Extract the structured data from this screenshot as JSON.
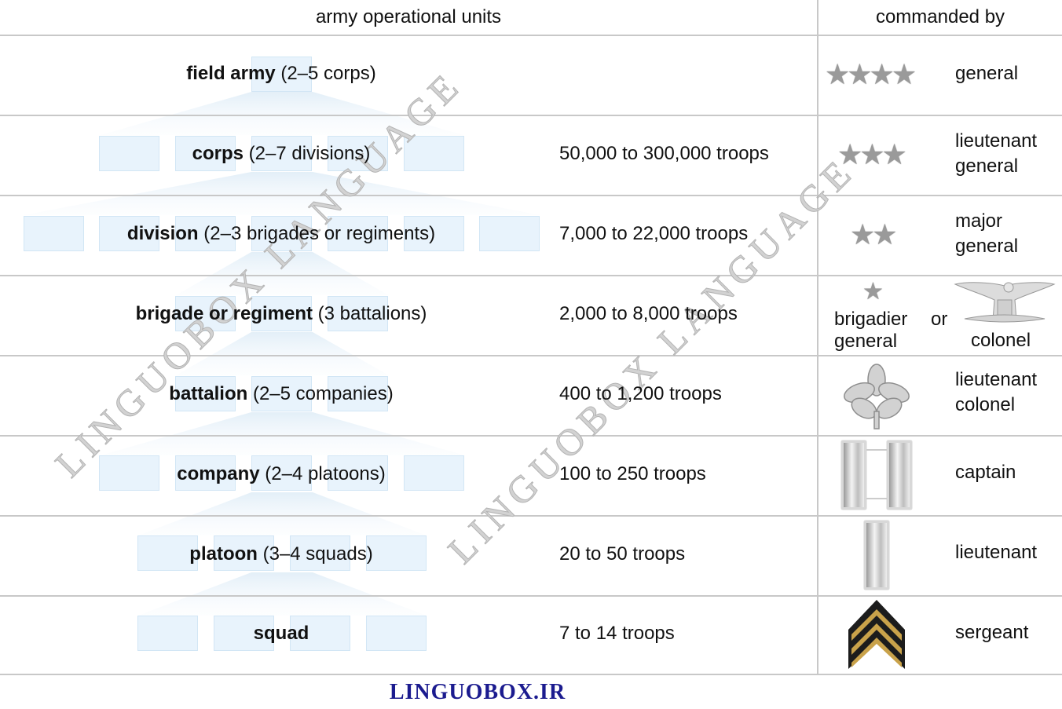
{
  "headers": {
    "units": "army operational units",
    "commanded_by": "commanded by"
  },
  "rows": [
    {
      "unit": "field army",
      "detail": " (2–5 corps)",
      "troops": "",
      "rank": "general",
      "insignia": "four-stars-icon"
    },
    {
      "unit": "corps",
      "detail": " (2–7 divisions)",
      "troops": "50,000 to 300,000 troops",
      "rank": "lieutenant general",
      "insignia": "three-stars-icon"
    },
    {
      "unit": "division",
      "detail": " (2–3 brigades or regiments)",
      "troops": "7,000 to 22,000 troops",
      "rank": "major general",
      "insignia": "two-stars-icon"
    },
    {
      "unit": "brigade or regiment",
      "detail": " (3 battalions)",
      "troops": "2,000 to 8,000 troops",
      "rank_a": "brigadier general",
      "rank_or": "or",
      "rank_b": "colonel",
      "insignia": "one-star-icon / eagle-icon"
    },
    {
      "unit": "battalion",
      "detail": " (2–5 companies)",
      "troops": "400 to 1,200 troops",
      "rank": "lieutenant colonel",
      "insignia": "oak-leaf-icon"
    },
    {
      "unit": "company",
      "detail": " (2–4 platoons)",
      "troops": "100 to 250 troops",
      "rank": "captain",
      "insignia": "double-bar-icon"
    },
    {
      "unit": "platoon",
      "detail": " (3–4 squads)",
      "troops": "20 to 50 troops",
      "rank": "lieutenant",
      "insignia": "single-bar-icon"
    },
    {
      "unit": "squad",
      "detail": "",
      "troops": "7 to 14 troops",
      "rank": "sergeant",
      "insignia": "chevron-icon"
    }
  ],
  "watermark": "LINGUOBOX LANGUAGE",
  "footer": "LINGUOBOX.IR",
  "colors": {
    "box": "#e8f3fc",
    "chevron": "#c9a24a",
    "footer": "#1b1b8f"
  }
}
